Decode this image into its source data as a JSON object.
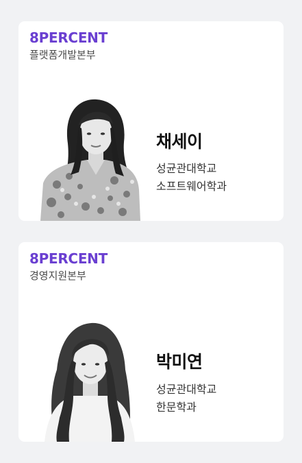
{
  "cards": [
    {
      "company": "8PERCENT",
      "department": "플랫폼개발본부",
      "name": "채세이",
      "school": "성균관대학교",
      "major": "소프트웨어학과"
    },
    {
      "company": "8PERCENT",
      "department": "경영지원본부",
      "name": "박미연",
      "school": "성균관대학교",
      "major": "한문학과"
    }
  ],
  "colors": {
    "page_background": "#f1f2f4",
    "card_background": "#ffffff",
    "brand_purple": "#6a3fd1"
  }
}
